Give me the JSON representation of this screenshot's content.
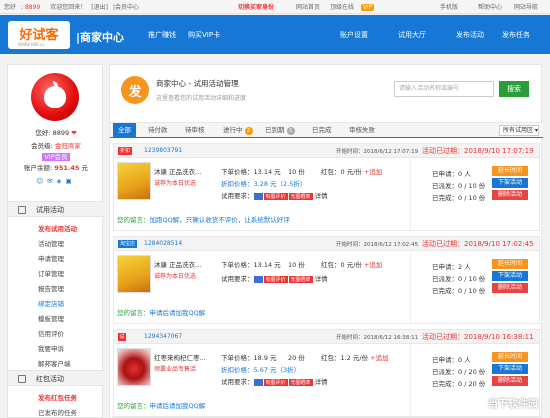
{
  "topbar": {
    "greeting": "您好",
    "user": "8899",
    "welcome": "欢迎您回来！",
    "logout": "[退出]",
    "biz": "|会员中心",
    "switch_buyer": "切换买家身份",
    "home": "网站首页",
    "vip": "顶级在线",
    "vip_badge": "VIP",
    "phone": "手机版",
    "help": "帮助中心",
    "navigation": "网站导航"
  },
  "header": {
    "logo": "好试客",
    "logo_url": "WWW.HSK.cc",
    "logo_sub": "商家中心",
    "nav": [
      "推广赚钱",
      "购买VIP卡",
      "账户设置",
      "试用大厅",
      "发布活动",
      "发布任务"
    ]
  },
  "profile": {
    "name_label": "您好",
    "name": "8899",
    "level_label": "会员级:",
    "level": "金冠商家",
    "vip_tag": "VIP会员",
    "balance_label": "账户余额:",
    "balance": "951.45",
    "balance_unit": "元"
  },
  "sidebar": {
    "section1": "试用活动",
    "items1": [
      "发布试用活动",
      "活动管理",
      "申请管理",
      "订单管理",
      "报告管理",
      "绑定店铺",
      "模板管理",
      "信用评价",
      "我要申诉",
      "解邦客户端"
    ],
    "section2": "红包活动",
    "items2": [
      "发布红包任务",
      "已发布的任务"
    ]
  },
  "content": {
    "fa": "发",
    "title": "商家中心 - 试用活动管理",
    "subtitle": "这里查看您的试用活动详细和进度",
    "search_placeholder": "请输入活动名称或编号",
    "search_btn": "搜索",
    "tabs": [
      {
        "label": "全部"
      },
      {
        "label": "待付款"
      },
      {
        "label": "待审核"
      },
      {
        "label": "进行中",
        "badge": "2"
      },
      {
        "label": "已到期",
        "badge": "3"
      },
      {
        "label": "已完成"
      },
      {
        "label": "审核失败"
      }
    ],
    "filter": "所有试用区"
  },
  "orders": [
    {
      "type": "折扣",
      "id": "1239803791",
      "start": "开始时间：2018/6/12 17:07:19",
      "expired": "活动已过期：2018/9/10 17:07:19",
      "name": "沐康 正品洗衣...",
      "tag": "诚荐为本日优选",
      "price_label": "下单价格：",
      "price": "13.14 元",
      "qty": "10 份",
      "redpack_label": "红包：",
      "redpack": "0 元/份",
      "add": "+追加",
      "discount_label": "折扣价格：",
      "discount": "3.28 元（2.5折）",
      "req_label": "试用要求：",
      "req": "有图评价",
      "req2": "无图晒单",
      "detail": "详情",
      "note_label": "您的留言：",
      "note": "加跑QQ解，只确认收货不评价，让系统默认好评",
      "stats": [
        "已申请：0 人",
        "已派发：0 / 10 份",
        "已完成：0 / 10 份"
      ],
      "buttons": [
        "延长时间",
        "下架活动",
        "删除活动"
      ]
    },
    {
      "type": "淘宝店",
      "id": "1284028514",
      "start": "开始时间：2018/6/12 17:02:45",
      "expired": "活动已过期：2018/9/10 17:02:45",
      "name": "沐康 正品洗衣...",
      "tag": "诚荐为本日优选",
      "price_label": "下单价格：",
      "price": "13.14 元",
      "qty": "10 份",
      "redpack_label": "红包：",
      "redpack": "0 元/份",
      "add": "+追加",
      "discount_label": "",
      "discount": "",
      "req_label": "试用要求：",
      "req": "有图评价",
      "req2": "无图晒单",
      "detail": "详情",
      "note_label": "您的留言：",
      "note": "申请后请加我QQ解",
      "stats": [
        "已申请：2 人",
        "已派发：0 / 10 份",
        "已完成：0 / 10 份"
      ],
      "buttons": [
        "延长时间",
        "下架活动",
        "删除活动"
      ]
    },
    {
      "type": "试",
      "id": "1294347067",
      "start": "开始时间：2018/6/12 16:38:11",
      "expired": "活动已过期：2018/9/10 16:38:11",
      "name": "红枣来枸杞仁枣...",
      "tag": "倾囊业品专售活",
      "price_label": "下单价格：",
      "price": "18.9 元",
      "qty": "20 份",
      "redpack_label": "红包：",
      "redpack": "1.2 元/份",
      "add": "+追加",
      "discount_label": "折扣价格：",
      "discount": "5.67 元（3折）",
      "req_label": "试用要求：",
      "req": "有图评价",
      "req2": "无图晒单",
      "detail": "详情",
      "note_label": "您的留言：",
      "note": "申请后请加我QQ解",
      "stats": [
        "已申请：0 人",
        "已派发：0 / 20 份",
        "已完成：0 / 20 份"
      ],
      "buttons": [
        "延长时间",
        "下架活动",
        "删除活动"
      ]
    }
  ],
  "watermark": "当下软件园"
}
